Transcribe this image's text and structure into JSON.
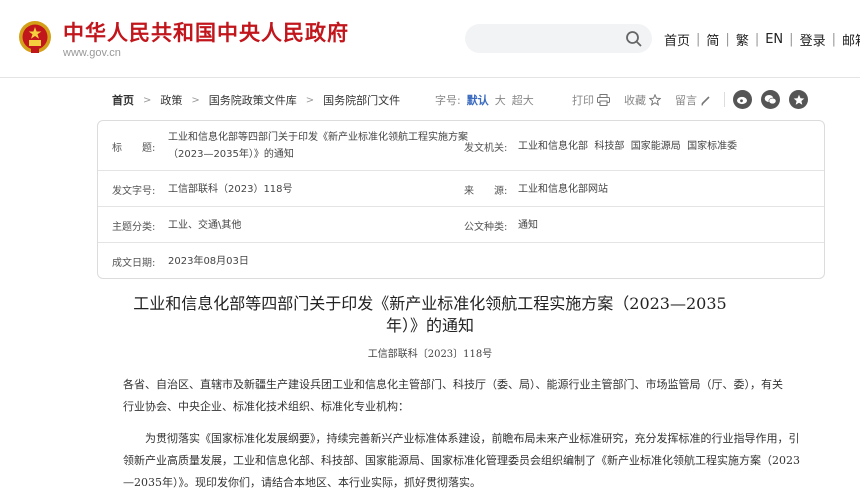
{
  "header": {
    "site_title": "中华人民共和国中央人民政府",
    "site_url": "www.gov.cn",
    "search_placeholder": "",
    "nav": [
      "首页",
      "简",
      "繁",
      "EN",
      "登录",
      "邮箱"
    ],
    "accent": "#c1161c"
  },
  "breadcrumb": [
    "首页",
    "政策",
    "国务院政策文件库",
    "国务院部门文件"
  ],
  "fontsize": {
    "label": "字号:",
    "options": [
      "默认",
      "大",
      "超大"
    ],
    "active": "默认"
  },
  "actions": {
    "print": "打印",
    "favorite": "收藏",
    "comment": "留言"
  },
  "share_icons": [
    "weibo-icon",
    "wechat-icon",
    "star-icon"
  ],
  "info": {
    "title_label": "标　　题:",
    "title_value": "工业和信息化部等四部门关于印发《新产业标准化领航工程实施方案（2023—2035年）》的通知",
    "issuer_label": "发文机关:",
    "issuer_value": "工业和信息化部  科技部  国家能源局  国家标准委",
    "docno_label": "发文字号:",
    "docno_value": "工信部联科（2023）118号",
    "source_label": "来　　源:",
    "source_value": "工业和信息化部网站",
    "topic_label": "主题分类:",
    "topic_value": "工业、交通\\其他",
    "type_label": "公文种类:",
    "type_value": "通知",
    "date_label": "成文日期:",
    "date_value": "2023年08月03日"
  },
  "article": {
    "title": "工业和信息化部等四部门关于印发《新产业标准化领航工程实施方案（2023—2035年）》的通知",
    "doc_no": "工信部联科〔2023〕118号",
    "p1": "各省、自治区、直辖市及新疆生产建设兵团工业和信息化主管部门、科技厅（委、局）、能源行业主管部门、市场监管局（厅、委），有关行业协会、中央企业、标准化技术组织、标准化专业机构：",
    "p2": "为贯彻落实《国家标准化发展纲要》，持续完善新兴产业标准体系建设，前瞻布局未来产业标准研究，充分发挥标准的行业指导作用，引领新产业高质量发展，工业和信息化部、科技部、国家能源局、国家标准化管理委员会组织编制了《新产业标准化领航工程实施方案（2023—2035年）》。现印发你们，请结合本地区、本行业实际，抓好贯彻落实。"
  }
}
